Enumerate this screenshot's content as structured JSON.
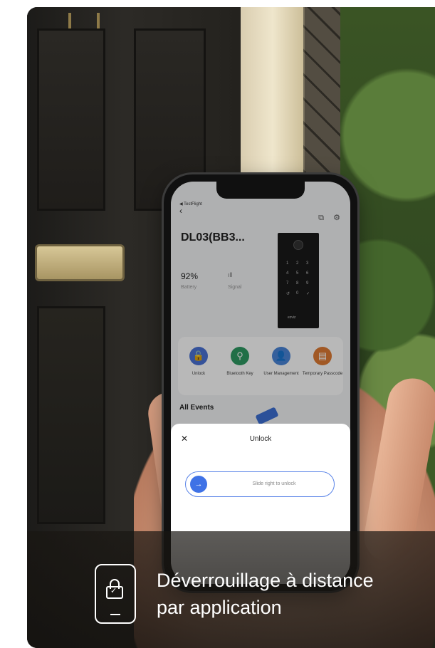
{
  "caption": {
    "line1": "Déverrouillage à distance",
    "line2": "par application",
    "icon": "phone-lock-icon"
  },
  "app": {
    "testflight_label": "◀ TestFlight",
    "back_icon": "chevron-left-icon",
    "device_name": "DL03(BB3...",
    "battery": {
      "value": "92%",
      "label": "Battery"
    },
    "signal": {
      "value": "ıll",
      "label": "Signal"
    },
    "lock_brand": "ezviz",
    "keypad": [
      "1",
      "2",
      "3",
      "4",
      "5",
      "6",
      "7",
      "8",
      "9",
      "↺",
      "0",
      "✓"
    ],
    "actions": [
      {
        "label": "Unlock",
        "color": "#4a72d6",
        "glyph": "🔓"
      },
      {
        "label": "Bluetooth Key",
        "color": "#2e9a63",
        "glyph": "⚲"
      },
      {
        "label": "User Management",
        "color": "#4a86d9",
        "glyph": "👤"
      },
      {
        "label": "Temporary Passcode",
        "color": "#e07b33",
        "glyph": "▤"
      }
    ],
    "events_title": "All Events"
  },
  "sheet": {
    "title": "Unlock",
    "close_glyph": "✕",
    "slider_text": "Slide right to unlock",
    "knob_glyph": "→"
  }
}
